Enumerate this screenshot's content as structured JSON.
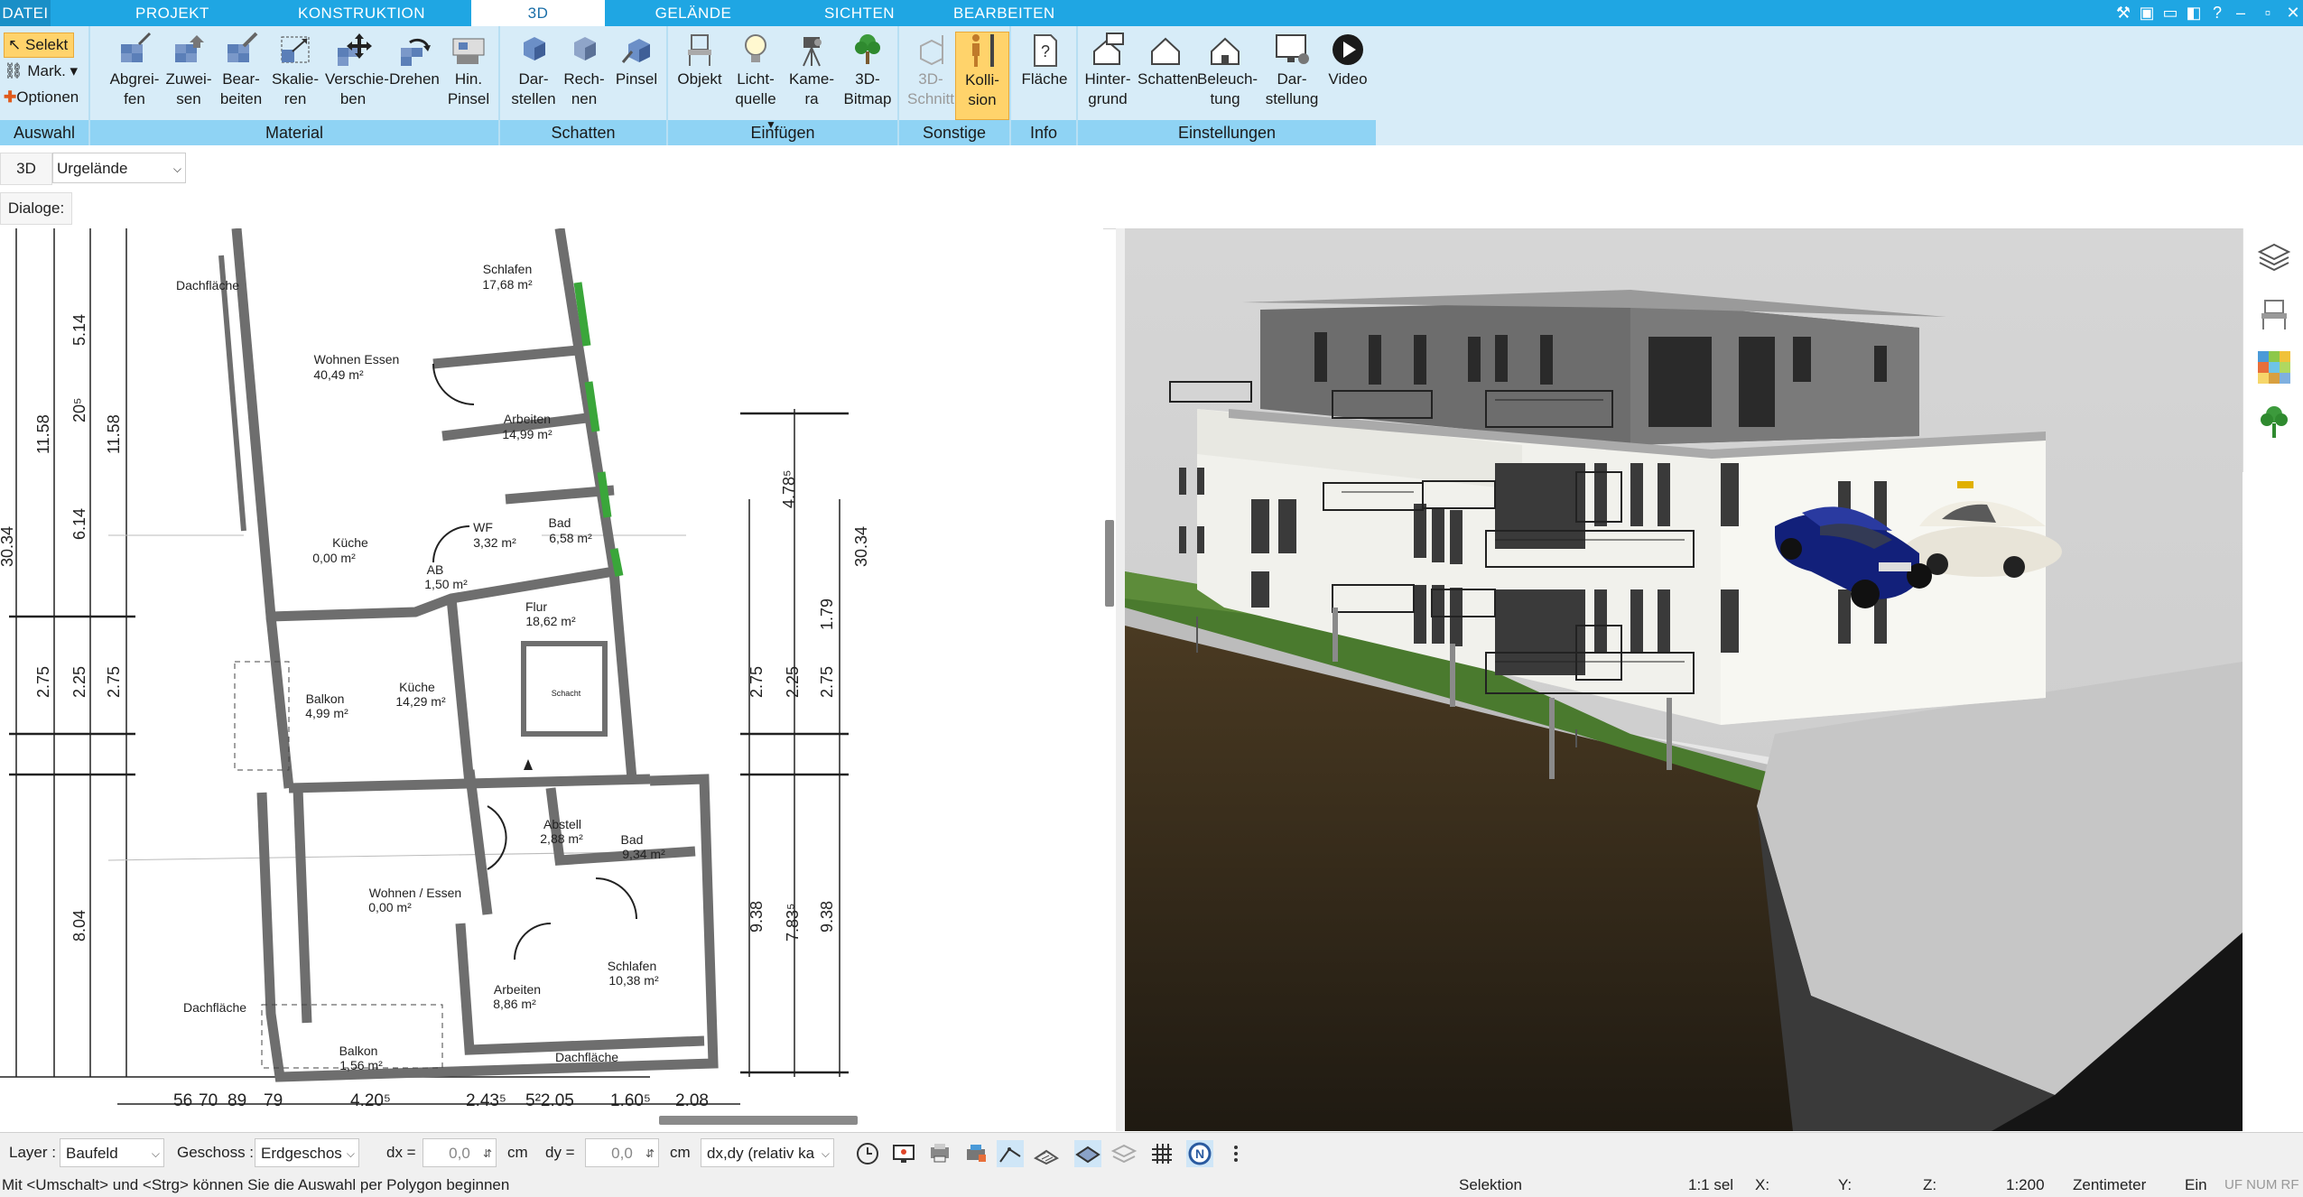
{
  "tabs": [
    "DATEI",
    "PROJEKT",
    "KONSTRUKTION",
    "3D",
    "GELÄNDE",
    "SICHTEN",
    "BEARBEITEN"
  ],
  "window_controls": [
    "tools-icon",
    "restore-icon",
    "minimize-icon",
    "help-icon",
    "minimize",
    "maximize",
    "close"
  ],
  "ribbon": {
    "auswahl": {
      "label": "Auswahl",
      "selekt": "Selekt",
      "mark": "Mark.",
      "optionen": "Optionen"
    },
    "material": {
      "label": "Material",
      "buttons": [
        "Abgrei-\nfen",
        "Zuwei-\nsen",
        "Bear-\nbeiten",
        "Skalie-\nren",
        "Verschie-\nben",
        "Drehen",
        "Hin.\nPinsel"
      ]
    },
    "schatten": {
      "label": "Schatten",
      "buttons": [
        "Dar-\nstellen",
        "Rech-\nnen",
        "Pinsel"
      ]
    },
    "einfuegen": {
      "label": "Einfügen",
      "buttons": [
        "Objekt",
        "Licht-\nquelle",
        "Kame-\nra",
        "3D-\nBitmap"
      ]
    },
    "sonstige": {
      "label": "Sonstige",
      "buttons": [
        "3D-\nSchnitt",
        "Kolli-\nsion"
      ]
    },
    "info": {
      "label": "Info",
      "buttons": [
        "Fläche"
      ]
    },
    "einstellungen": {
      "label": "Einstellungen",
      "buttons": [
        "Hinter-\ngrund",
        "Schatten",
        "Beleuch-\ntung",
        "Dar-\nstellung",
        "Video"
      ]
    }
  },
  "mode_row": {
    "mode": "3D",
    "terrain": "Urgelände"
  },
  "dialogs_label": "Dialoge:",
  "floorplan": {
    "rooms": [
      {
        "name": "Schlafen",
        "area": "17,68 m²"
      },
      {
        "name": "Wohnen Essen",
        "area": "40,49 m²"
      },
      {
        "name": "Arbeiten",
        "area": "14,99 m²"
      },
      {
        "name": "Küche",
        "area": "0,00 m²"
      },
      {
        "name": "WF",
        "area": "3,32 m²"
      },
      {
        "name": "Bad",
        "area": "6,58 m²"
      },
      {
        "name": "AB",
        "area": "1,50 m²"
      },
      {
        "name": "Flur",
        "area": "18,62 m²"
      },
      {
        "name": "Balkon",
        "area": "4,99 m²"
      },
      {
        "name": "Küche",
        "area": "14,29 m²"
      },
      {
        "name": "Abstell",
        "area": "2,88 m²"
      },
      {
        "name": "Bad",
        "area": "9,34 m²"
      },
      {
        "name": "Wohnen / Essen",
        "area": "0,00 m²"
      },
      {
        "name": "Schlafen",
        "area": "10,38 m²"
      },
      {
        "name": "Arbeiten",
        "area": "8,86 m²"
      },
      {
        "name": "Balkon",
        "area": "1,56 m²"
      }
    ],
    "labels": [
      "Dachfläche",
      "Dachfläche",
      "Dachfläche",
      "Schacht"
    ],
    "dims_vertical_left": [
      "30.34",
      "11.58",
      "6.14",
      "2.75",
      "8.04",
      "5.14",
      "20⁵",
      "11.58",
      "2.25",
      "2.75"
    ],
    "dims_vertical_right": [
      "30.34",
      "4.78⁵",
      "1.79",
      "2.75",
      "9.38",
      "9.38",
      "7.83⁵",
      "2.25",
      "2.75"
    ],
    "dims_bottom": [
      "56",
      "70",
      "89",
      "79",
      "4.20⁵",
      "2.43⁵",
      "5²2.05",
      "1.60⁵",
      "2.08"
    ]
  },
  "bottombar": {
    "layer_label": "Layer :",
    "layer_value": "Baufeld",
    "geschoss_label": "Geschoss :",
    "geschoss_value": "Erdgeschos",
    "dx_label": "dx =",
    "dx_value": "0,0",
    "dx_unit": "cm",
    "dy_label": "dy =",
    "dy_value": "0,0",
    "dy_unit": "cm",
    "mode_value": "dx,dy (relativ ka"
  },
  "statusbar": {
    "hint": "Mit <Umschalt> und <Strg> können Sie die Auswahl per Polygon beginnen",
    "mode": "Selektion",
    "sel": "1:1 sel",
    "x": "X:",
    "y": "Y:",
    "z": "Z:",
    "scale": "1:200",
    "unit": "Zentimeter",
    "ein": "Ein",
    "flags": "UF NUM RF"
  },
  "colors": {
    "tab_blue": "#1fa6e3",
    "ribbon_bg": "#d7ecf8",
    "group_label": "#8fd3f4",
    "highlight": "#ffd36b",
    "wall": "#6e6e6e",
    "grass": "#4a7a2e",
    "car_blue": "#12207a"
  }
}
